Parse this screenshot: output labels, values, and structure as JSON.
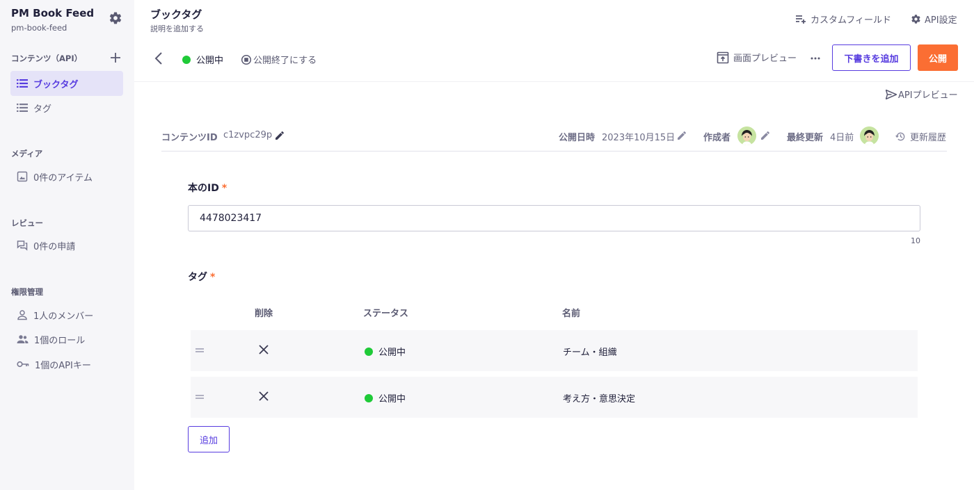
{
  "sidebar": {
    "service_name": "PM Book Feed",
    "service_id": "pm-book-feed",
    "content_section": "コンテンツ（API）",
    "content_items": [
      {
        "label": "ブックタグ",
        "icon": "list-icon",
        "active": true
      },
      {
        "label": "タグ",
        "icon": "list-icon",
        "active": false
      }
    ],
    "media_section": "メディア",
    "media_item": "0件のアイテム",
    "review_section": "レビュー",
    "review_item": "0件の申請",
    "permission_section": "権限管理",
    "permission_items": [
      {
        "label": "1人のメンバー",
        "icon": "person-icon"
      },
      {
        "label": "1個のロール",
        "icon": "group-icon"
      },
      {
        "label": "1個のAPIキー",
        "icon": "key-icon"
      }
    ]
  },
  "header": {
    "title": "ブックタグ",
    "subtitle": "説明を追加する",
    "custom_field_link": "カスタムフィールド",
    "api_settings_link": "API設定"
  },
  "toolbar": {
    "status": "公開中",
    "unpublish": "公開終了にする",
    "preview": "画面プレビュー",
    "draft_button": "下書きを追加",
    "publish_button": "公開",
    "api_preview": "APIプレビュー"
  },
  "meta": {
    "content_id_label": "コンテンツID",
    "content_id": "c1zvpc29p",
    "published_label": "公開日時",
    "published_at": "2023年10月15日",
    "author_label": "作成者",
    "updated_label": "最終更新",
    "updated_at": "4日前",
    "history_link": "更新履歴"
  },
  "form": {
    "book_id_label": "本のID",
    "book_id_value": "4478023417",
    "book_id_count": "10",
    "tags_label": "タグ",
    "required_mark": "*",
    "columns": {
      "delete": "削除",
      "status": "ステータス",
      "name": "名前"
    },
    "rows": [
      {
        "status": "公開中",
        "name": "チーム・組織"
      },
      {
        "status": "公開中",
        "name": "考え方・意思決定"
      }
    ],
    "add_button": "追加"
  },
  "colors": {
    "accent": "#563bdf",
    "publish": "#fb6e33",
    "status_green": "#1fca38"
  }
}
